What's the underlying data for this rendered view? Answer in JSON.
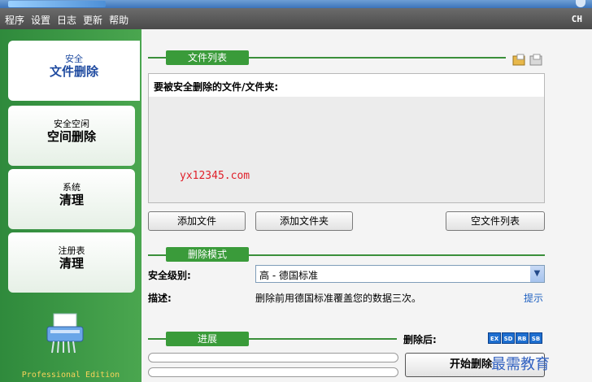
{
  "menu": [
    "程序",
    "设置",
    "日志",
    "更新",
    "帮助"
  ],
  "language": "CH",
  "nav": [
    {
      "small": "安全",
      "big": "文件删除"
    },
    {
      "small": "安全空闲",
      "big": "空间删除"
    },
    {
      "small": "系统",
      "big": "清理"
    },
    {
      "small": "注册表",
      "big": "清理"
    }
  ],
  "edition": "Professional Edition",
  "file_section": {
    "title": "文件列表",
    "list_header": "要被安全删除的文件/文件夹:",
    "watermark": "yx12345.com",
    "add_file": "添加文件",
    "add_folder": "添加文件夹",
    "clear_list": "空文件列表"
  },
  "delete_mode": {
    "title": "删除模式",
    "level_label": "安全级别:",
    "level_value": "高 - 德国标准",
    "desc_label": "描述:",
    "desc_value": "删除前用德国标准覆盖您的数据三次。",
    "hint": "提示"
  },
  "progress": {
    "title": "进展",
    "after_label": "删除后:",
    "badges": [
      "EX",
      "SD",
      "RB",
      "SB"
    ],
    "start_label": "开始删除",
    "corner_text": "最需教育"
  }
}
